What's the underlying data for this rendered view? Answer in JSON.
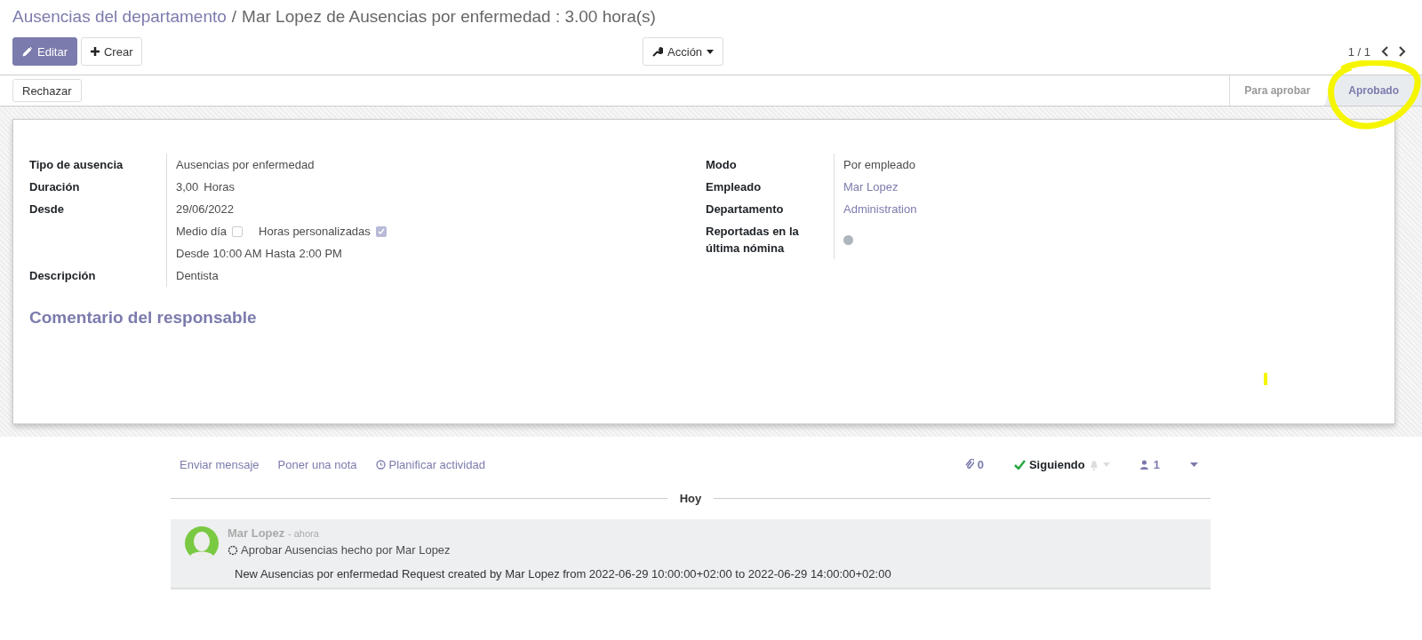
{
  "breadcrumb": {
    "parent": "Ausencias del departamento",
    "separator": "/",
    "current": "Mar Lopez de Ausencias por enfermedad : 3.00 hora(s)"
  },
  "buttons": {
    "edit": "Editar",
    "create": "Crear",
    "action": "Acción"
  },
  "pager": "1 / 1",
  "header_buttons": [
    "Rechazar"
  ],
  "statusbar": [
    {
      "label": "Para aprobar",
      "selected": false
    },
    {
      "label": "Aprobado",
      "selected": true
    }
  ],
  "fields_left": [
    {
      "kind": "text",
      "label": "Tipo de ausencia",
      "value": "Ausencias por enfermedad"
    },
    {
      "kind": "duration",
      "label": "Duración",
      "value": "3,00",
      "unit": "Horas"
    },
    {
      "kind": "text",
      "label": "Desde",
      "value": "29/06/2022"
    },
    {
      "kind": "options",
      "options": [
        {
          "label": "Medio día",
          "checked": false
        },
        {
          "label": "Horas personalizadas",
          "checked": true
        }
      ]
    },
    {
      "kind": "range",
      "from_label": "Desde",
      "from": "10:00 AM",
      "to_label": "Hasta",
      "to": "2:00 PM"
    },
    {
      "kind": "text",
      "label": "Descripción",
      "value": "Dentista"
    }
  ],
  "fields_right": [
    {
      "kind": "text",
      "label": "Modo",
      "value": "Por empleado"
    },
    {
      "kind": "link",
      "label": "Empleado",
      "value": "Mar Lopez"
    },
    {
      "kind": "link",
      "label": "Departamento",
      "value": "Administration"
    },
    {
      "kind": "dot",
      "label": "Reportadas en la última nómina",
      "on": false
    }
  ],
  "section_title": "Comentario del responsable",
  "chatter": {
    "actions": [
      "Enviar mensaje",
      "Poner una nota",
      "Planificar actividad"
    ],
    "attachments": "0",
    "following": true,
    "following_label": "Siguiendo",
    "followers": "1",
    "separator": "Hoy",
    "messages": [
      {
        "author": "Mar Lopez",
        "date": "- ahora",
        "subtype": "Aprobar Ausencias hecho por Mar Lopez",
        "body": "New Ausencias por enfermedad Request created by Mar Lopez from 2022-06-29 10:00:00+02:00 to 2022-06-29 14:00:00+02:00"
      }
    ]
  }
}
